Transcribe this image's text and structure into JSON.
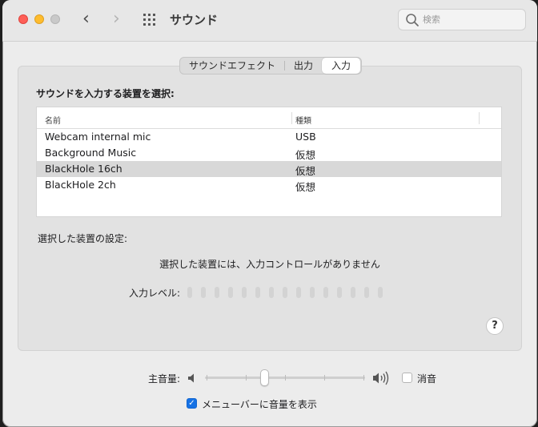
{
  "window": {
    "title": "サウンド"
  },
  "toolbar": {
    "back_glyph": "‹",
    "forward_glyph": "›"
  },
  "search": {
    "placeholder": "検索",
    "value": ""
  },
  "tabs": [
    {
      "label": "サウンドエフェクト",
      "selected": false
    },
    {
      "label": "出力",
      "selected": false
    },
    {
      "label": "入力",
      "selected": true
    }
  ],
  "input_section": {
    "heading": "サウンドを入力する装置を選択:",
    "columns": [
      "名前",
      "種類"
    ],
    "rows": [
      {
        "name": "Webcam internal mic",
        "type": "USB",
        "selected": false
      },
      {
        "name": "Background Music",
        "type": "仮想",
        "selected": false
      },
      {
        "name": "BlackHole 16ch",
        "type": "仮想",
        "selected": true
      },
      {
        "name": "BlackHole 2ch",
        "type": "仮想",
        "selected": false
      }
    ]
  },
  "settings": {
    "heading": "選択した装置の設定:",
    "message": "選択した装置には、入力コントロールがありません",
    "level_label": "入力レベル:",
    "level_active_bars": 0,
    "level_total_bars": 15
  },
  "help": {
    "label": "?"
  },
  "volume": {
    "label": "主音量:",
    "level": 0.37,
    "mute_label": "消音",
    "muted": false
  },
  "menubar": {
    "label": "メニューバーに音量を表示",
    "checked": true,
    "check_glyph": "✓"
  },
  "colors": {
    "accent": "#1672e5",
    "close": "#fe5f57",
    "minimize": "#febc2e",
    "selected_row": "#d8d8d8"
  }
}
